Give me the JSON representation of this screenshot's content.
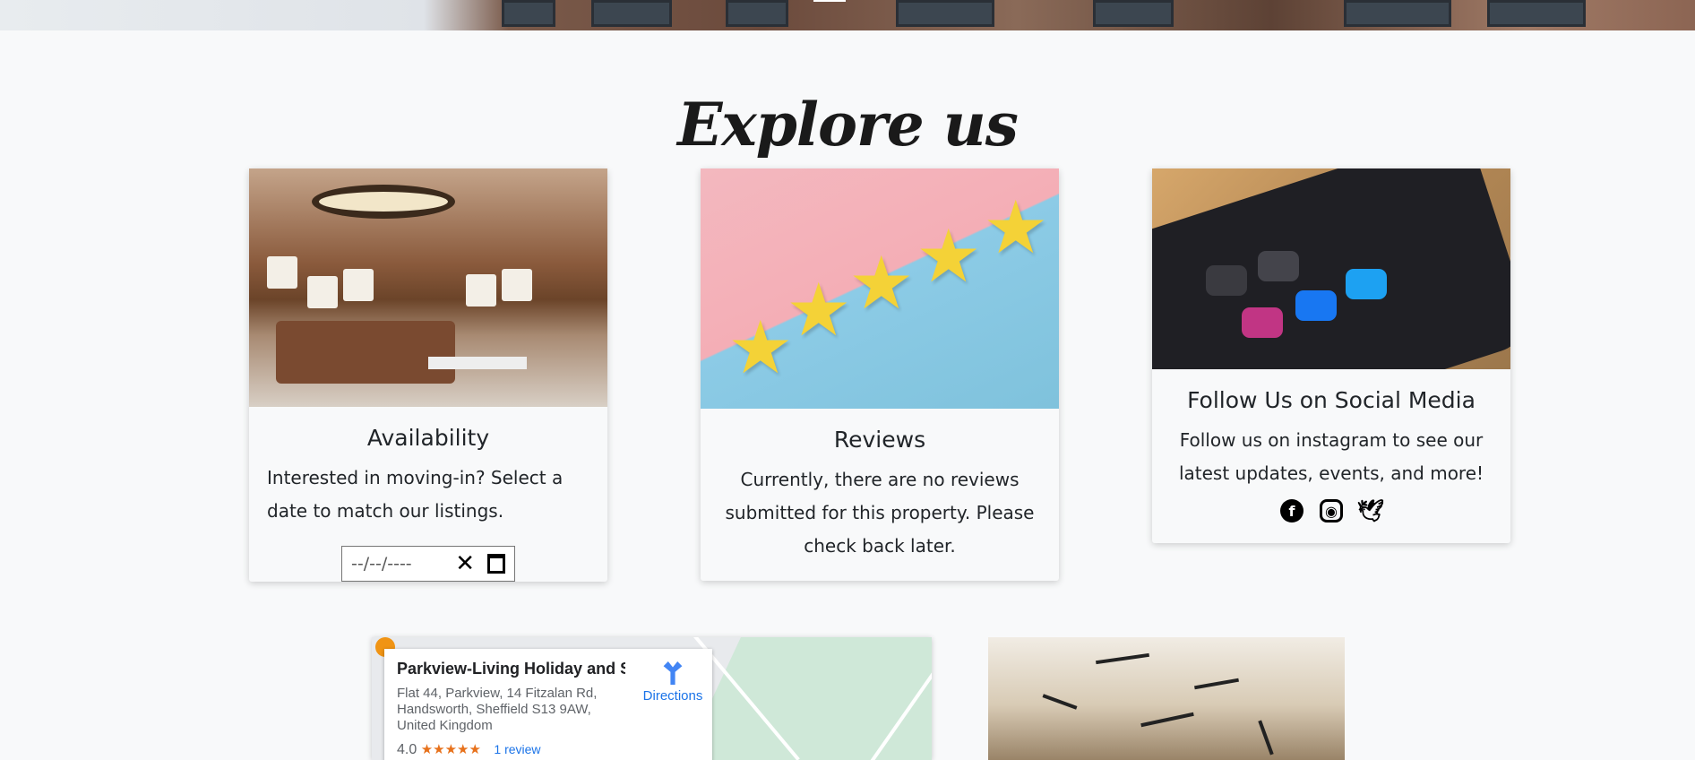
{
  "section": {
    "title": "Explore us"
  },
  "availability": {
    "title": "Availability",
    "text": "Interested in moving-in? Select a date to match our listings.",
    "date_placeholder": "--/--/----",
    "clear_glyph": "✕"
  },
  "reviews": {
    "title": "Reviews",
    "text": "Currently, there are no reviews submitted for this property. Please check back later."
  },
  "social": {
    "title": "Follow Us on Social Media",
    "text": "Follow us on instagram to see our latest updates, events, and more!",
    "icons": [
      "facebook-icon",
      "instagram-icon",
      "twitter-icon"
    ]
  },
  "map": {
    "place_name": "Parkview-Living Holiday and S...",
    "address": "Flat 44, Parkview, 14 Fitzalan Rd, Handsworth, Sheffield S13 9AW, United Kingdom",
    "rating": "4.0",
    "stars": "★★★★★",
    "review_link": "1 review",
    "directions_label": "Directions"
  },
  "colors": {
    "background": "#f8f9fa",
    "link": "#1a73e8",
    "star": "#f4d237"
  }
}
